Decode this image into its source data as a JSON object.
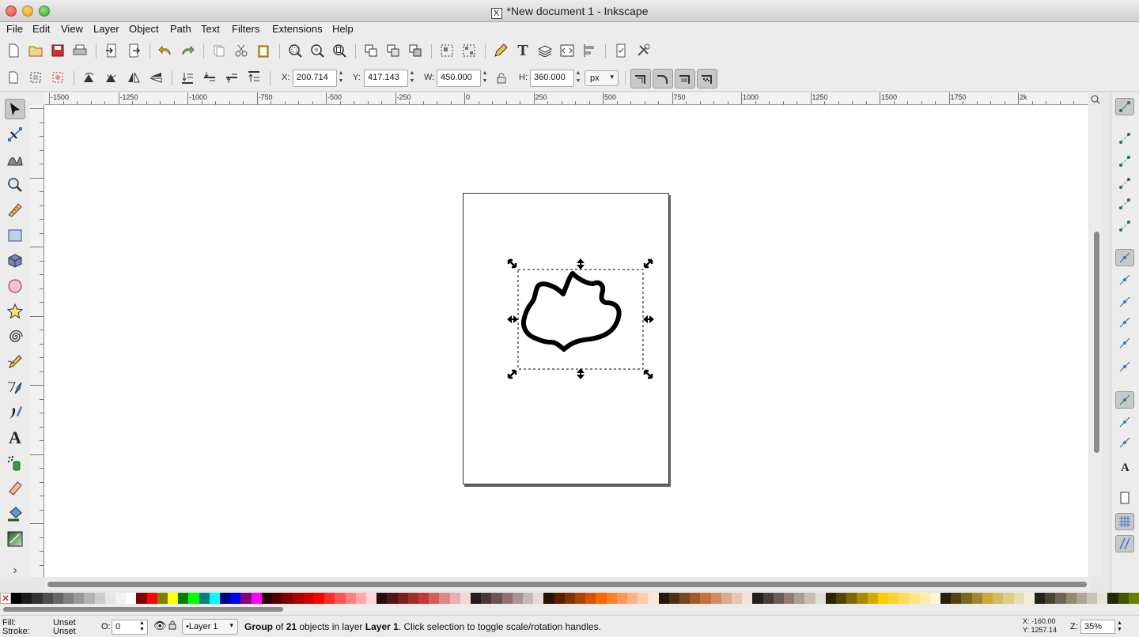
{
  "window": {
    "title": "*New document 1 - Inkscape",
    "x_glyph": "X"
  },
  "menu": [
    "File",
    "Edit",
    "View",
    "Layer",
    "Object",
    "Path",
    "Text",
    "Filters",
    "Extensions",
    "Help"
  ],
  "command_bar_icons": [
    "new-document-icon",
    "open-document-icon",
    "save-document-icon",
    "print-icon",
    "import-icon",
    "export-icon",
    "undo-icon",
    "redo-icon",
    "duplicate-icon",
    "cut-icon",
    "paste-icon",
    "zoom-selection-icon",
    "zoom-drawing-icon",
    "zoom-page-icon",
    "duplicate-object-icon",
    "clone-icon",
    "unlink-clone-icon",
    "group-icon",
    "ungroup-icon",
    "xml-editor-pen-icon",
    "text-font-icon",
    "layers-icon",
    "xml-editor-icon",
    "align-distribute-icon",
    "document-properties-icon",
    "preferences-icon"
  ],
  "transform": {
    "x_label": "X:",
    "x_value": "200.714",
    "y_label": "Y:",
    "y_value": "417.143",
    "w_label": "W:",
    "w_value": "450.000",
    "h_label": "H:",
    "h_value": "360.000",
    "unit": "px"
  },
  "ruler": {
    "labels": [
      "-1500",
      "-1250",
      "-1000",
      "-750",
      "-500",
      "-250",
      "0",
      "250",
      "500",
      "750",
      "1000",
      "1250",
      "1500",
      "1750",
      "2k"
    ]
  },
  "tools": [
    "selector-tool-icon",
    "node-tool-icon",
    "tweak-tool-icon",
    "zoom-tool-icon",
    "measure-tool-icon",
    "rectangle-tool-icon",
    "3d-box-tool-icon",
    "ellipse-tool-icon",
    "star-tool-icon",
    "spiral-tool-icon",
    "pencil-tool-icon",
    "pen-tool-icon",
    "calligraphy-tool-icon",
    "text-tool-icon",
    "spray-tool-icon",
    "eraser-tool-icon",
    "paint-bucket-tool-icon",
    "gradient-tool-icon"
  ],
  "toolbox_more": "›",
  "palette_colors": [
    "#000000",
    "#1a1a1a",
    "#333333",
    "#4d4d4d",
    "#666666",
    "#808080",
    "#999999",
    "#b3b3b3",
    "#cccccc",
    "#e6e6e6",
    "#f2f2f2",
    "#ffffff",
    "#800000",
    "#ff0000",
    "#808000",
    "#ffff00",
    "#008000",
    "#00ff00",
    "#008080",
    "#00ffff",
    "#000080",
    "#0000ff",
    "#800080",
    "#ff00ff",
    "#2b0000",
    "#550000",
    "#800000",
    "#aa0000",
    "#d40000",
    "#ff0000",
    "#ff2a2a",
    "#ff5555",
    "#ff8080",
    "#ffaaaa",
    "#ffd5d5",
    "#280b0b",
    "#501616",
    "#782121",
    "#a02c2c",
    "#c83737",
    "#d35f5f",
    "#de8787",
    "#e9afaf",
    "#f4d7d7",
    "#241c1c",
    "#483737",
    "#6c5353",
    "#916f6f",
    "#ac9393",
    "#c8b7b7",
    "#e3dbdb",
    "#2b1100",
    "#552200",
    "#803300",
    "#aa4400",
    "#d45500",
    "#ff6600",
    "#ff7f2a",
    "#ff9955",
    "#ffb380",
    "#ffccaa",
    "#ffe6d5",
    "#28170b",
    "#502d16",
    "#784421",
    "#a05a2c",
    "#c87137",
    "#d38d5f",
    "#deaa87",
    "#e9c6af",
    "#f4e3d7",
    "#241f1c",
    "#483e37",
    "#6c5d53",
    "#917c6f",
    "#ac9d93",
    "#c8beb7",
    "#e3dedb",
    "#2b2200",
    "#554400",
    "#806600",
    "#aa8800",
    "#d4aa00",
    "#ffcc00",
    "#ffd42a",
    "#ffdd55",
    "#ffe680",
    "#ffeeaa",
    "#fff6d5",
    "#28220b",
    "#504416",
    "#786721",
    "#a0892c",
    "#c8ab37",
    "#d3bc5f",
    "#decd87",
    "#e9ddaf",
    "#f4eed7",
    "#24221c",
    "#484537",
    "#6c6753",
    "#918a6f",
    "#aca793",
    "#c8c4b7",
    "#e3e2db",
    "#222b00",
    "#445500",
    "#668000"
  ],
  "snap_icons": [
    "snap-toggle-icon",
    "snap-bounding-box-icon",
    "snap-bbox-edges-icon",
    "snap-bbox-corners-icon",
    "snap-bbox-edge-midpoints-icon",
    "snap-bbox-center-icon",
    "snap-nodes-icon",
    "snap-cusp-nodes-icon",
    "snap-paths-icon",
    "snap-smooth-nodes-icon",
    "snap-midpoints-icon",
    "snap-intersections-icon",
    "snap-others-icon",
    "snap-object-centers-icon",
    "snap-rotation-centers-icon",
    "snap-text-baseline-icon",
    "snap-page-border-icon",
    "snap-grid-icon",
    "snap-guides-icon"
  ],
  "status": {
    "fill_label": "Fill:",
    "fill_value": "Unset",
    "stroke_label": "Stroke:",
    "stroke_value": "Unset",
    "opacity_label": "O:",
    "opacity_value": "0",
    "layer": "•Layer 1",
    "msg_pre": "Group",
    "msg_of": " of ",
    "msg_count": "21",
    "msg_mid": " objects in layer ",
    "msg_layer": "Layer 1",
    "msg_post": ". Click selection to toggle scale/rotation handles.",
    "cursor_x": "X: -160.00",
    "cursor_y": "Y: 1257.14",
    "zoom_label": "Z:",
    "zoom_value": "35%"
  }
}
